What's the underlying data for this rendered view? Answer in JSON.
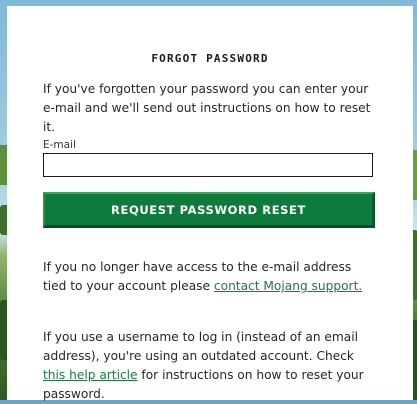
{
  "form": {
    "title": "FORGOT PASSWORD",
    "intro": "If you've forgotten your password you can enter your e-mail and we'll send out instructions on how to reset it.",
    "email_label": "E-mail",
    "email_value": "",
    "email_placeholder": "",
    "submit_label": "REQUEST PASSWORD RESET"
  },
  "help": {
    "no_access_text": "If you no longer have access to the e-mail address tied to your account please ",
    "contact_link": "contact Mojang support.",
    "username_text_1": "If you use a username to log in (instead of an email address), you're using an outdated account. Check ",
    "article_link": "this help article",
    "username_text_2": " for instructions on how to reset your password."
  },
  "colors": {
    "accent": "#0e7a3c",
    "link": "#1f7a3f"
  }
}
